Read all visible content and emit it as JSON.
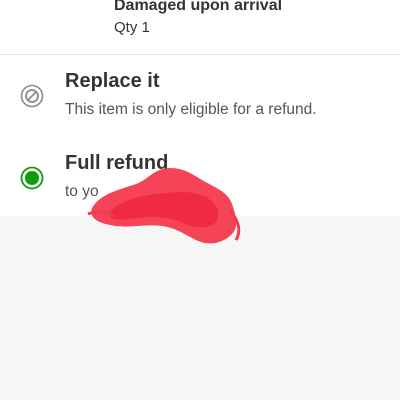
{
  "item": {
    "reason": "Damaged upon arrival",
    "qty": "Qty 1"
  },
  "options": [
    {
      "title": "Replace it",
      "description": "This item is only eligible for a refund.",
      "state": "disabled",
      "icon": "disabled-radio-icon"
    },
    {
      "title": "Full refund",
      "description": "to yo",
      "state": "selected",
      "icon": "selected-radio-icon"
    }
  ],
  "colors": {
    "selected_green": "#0f9d0f",
    "disabled_gray": "#8a8a8a",
    "redaction_red": "#f43a4e",
    "page_background": "#f6f6f6"
  }
}
